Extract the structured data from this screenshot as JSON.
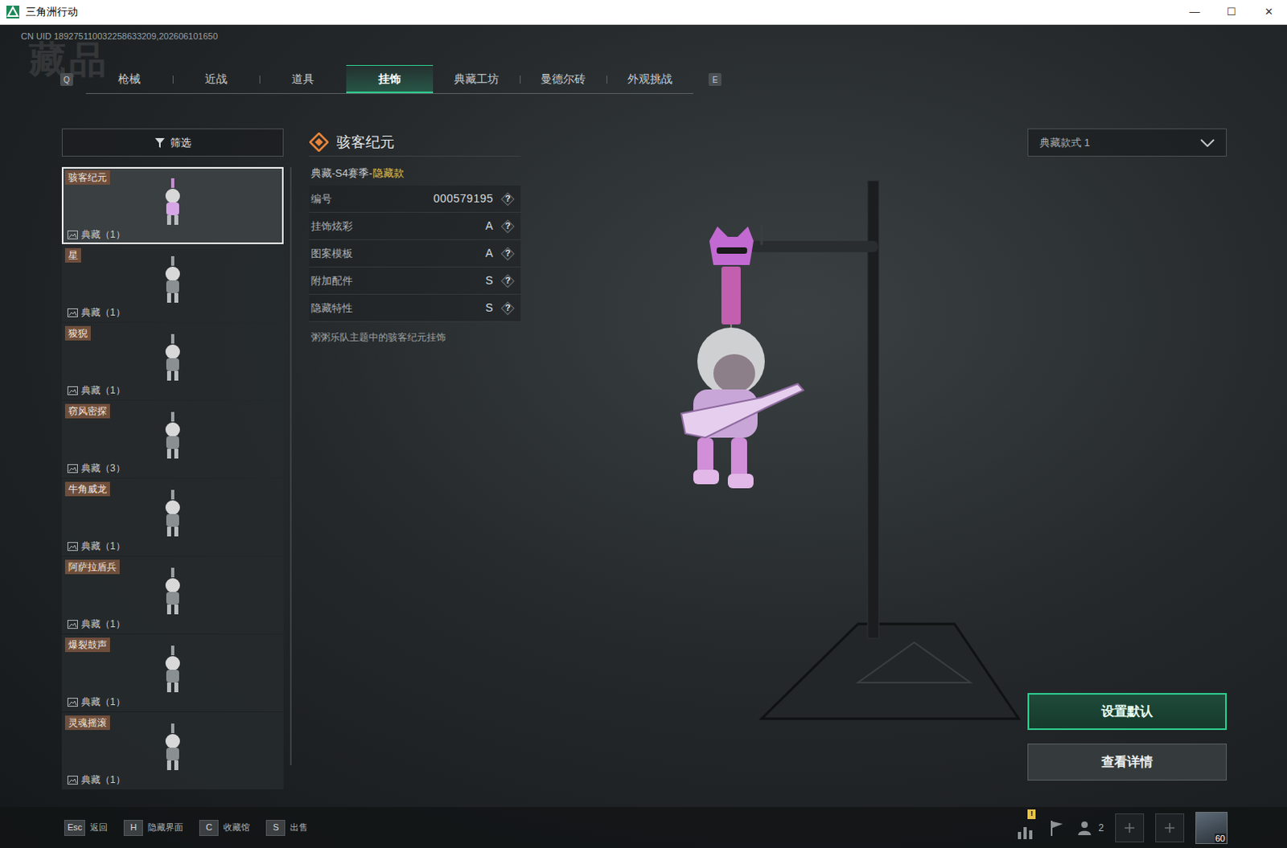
{
  "window": {
    "title": "三角洲行动",
    "controls": [
      "—",
      "☐",
      "✕"
    ]
  },
  "uid": "CN UID 189275110032258633209,202606101650",
  "watermark": "藏品",
  "tabs": {
    "prev_key": "Q",
    "next_key": "E",
    "items": [
      {
        "label": "枪械",
        "selected": false
      },
      {
        "label": "近战",
        "selected": false
      },
      {
        "label": "道具",
        "selected": false
      },
      {
        "label": "挂饰",
        "selected": true
      },
      {
        "label": "典藏工坊",
        "selected": false
      },
      {
        "label": "曼德尔砖",
        "selected": false
      },
      {
        "label": "外观挑战",
        "selected": false
      }
    ]
  },
  "filter": {
    "label": "筛选"
  },
  "list": [
    {
      "name": "骇客纪元",
      "count": "典藏（1）",
      "selected": true
    },
    {
      "name": "星",
      "count": "典藏（1）",
      "selected": false
    },
    {
      "name": "狻猊",
      "count": "典藏（1）",
      "selected": false
    },
    {
      "name": "窃风密探",
      "count": "典藏（3）",
      "selected": false
    },
    {
      "name": "牛角威龙",
      "count": "典藏（1）",
      "selected": false
    },
    {
      "name": "阿萨拉盾兵",
      "count": "典藏（1）",
      "selected": false
    },
    {
      "name": "爆裂鼓声",
      "count": "典藏（1）",
      "selected": false
    },
    {
      "name": "灵魂摇滚",
      "count": "典藏（1）",
      "selected": false
    }
  ],
  "detail": {
    "title": "骇客纪元",
    "tier": "典藏-S4赛季-",
    "variant": "隐藏款",
    "rows": [
      {
        "label": "编号",
        "value": "000579195",
        "help": "?"
      },
      {
        "label": "挂饰炫彩",
        "value": "A",
        "help": "?"
      },
      {
        "label": "图案模板",
        "value": "A",
        "help": "?"
      },
      {
        "label": "附加配件",
        "value": "S",
        "help": "?"
      },
      {
        "label": "隐藏特性",
        "value": "S",
        "help": "?"
      }
    ],
    "description": "粥粥乐队主题中的骇客纪元挂饰"
  },
  "style_select": {
    "value": "典藏款式 1"
  },
  "buttons": [
    {
      "label": "设置默认",
      "primary": true
    },
    {
      "label": "查看详情",
      "primary": false
    }
  ],
  "hotkeys": [
    {
      "key": "Esc",
      "label": "返回"
    },
    {
      "key": "H",
      "label": "隐藏界面"
    },
    {
      "key": "C",
      "label": "收藏馆"
    },
    {
      "key": "S",
      "label": "出售"
    }
  ],
  "tray": {
    "alert": "!",
    "party_count": "2",
    "level": "60"
  }
}
